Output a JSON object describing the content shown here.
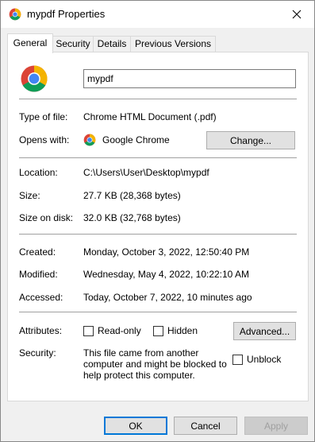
{
  "window": {
    "title": "mypdf Properties"
  },
  "tabs": [
    {
      "label": "General",
      "active": true
    },
    {
      "label": "Security",
      "active": false
    },
    {
      "label": "Details",
      "active": false
    },
    {
      "label": "Previous Versions",
      "active": false
    }
  ],
  "general": {
    "file_name": "mypdf",
    "type_of_file_label": "Type of file:",
    "type_of_file_value": "Chrome HTML Document (.pdf)",
    "opens_with_label": "Opens with:",
    "opens_with_value": "Google Chrome",
    "change_button": "Change...",
    "location_label": "Location:",
    "location_value": "C:\\Users\\User\\Desktop\\mypdf",
    "size_label": "Size:",
    "size_value": "27.7 KB (28,368 bytes)",
    "size_on_disk_label": "Size on disk:",
    "size_on_disk_value": "32.0 KB (32,768 bytes)",
    "created_label": "Created:",
    "created_value": "Monday, October 3, 2022, 12:50:40 PM",
    "modified_label": "Modified:",
    "modified_value": "Wednesday, May 4, 2022, 10:22:10 AM",
    "accessed_label": "Accessed:",
    "accessed_value": "Today, October 7, 2022, 10 minutes ago",
    "attributes_label": "Attributes:",
    "readonly_label": "Read-only",
    "readonly_checked": false,
    "hidden_label": "Hidden",
    "hidden_checked": false,
    "advanced_button": "Advanced...",
    "security_label": "Security:",
    "security_text_lines": [
      "This file came from another",
      "computer and might be blocked to",
      "help protect this computer."
    ],
    "unblock_label": "Unblock",
    "unblock_checked": false
  },
  "footer": {
    "ok_button": "OK",
    "cancel_button": "Cancel",
    "apply_button": "Apply"
  },
  "icons": {
    "app": "chrome-icon",
    "close": "close-icon"
  },
  "colors": {
    "chrome_red": "#db4437",
    "chrome_yellow": "#f4b400",
    "chrome_green": "#0f9d58",
    "chrome_blue": "#4285f4",
    "focus_border": "#0078d7"
  }
}
